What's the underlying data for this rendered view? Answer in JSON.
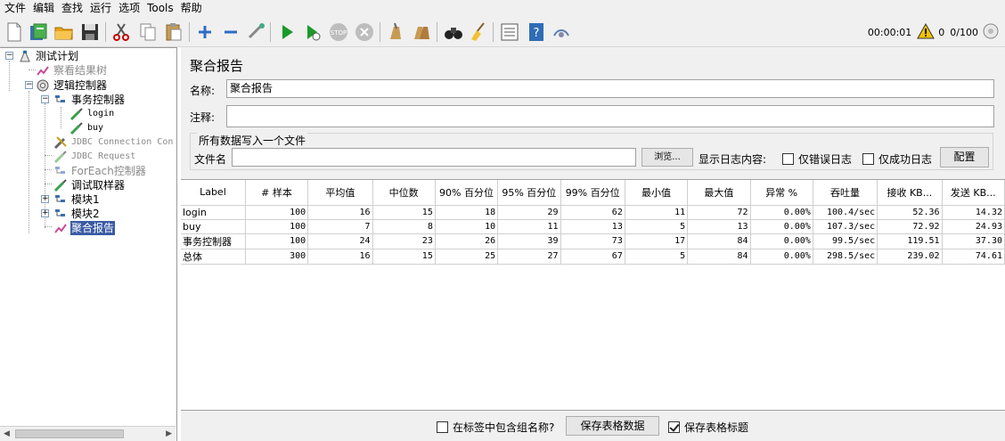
{
  "menu": [
    "文件",
    "编辑",
    "查找",
    "运行",
    "选项",
    "Tools",
    "帮助"
  ],
  "toolbar": {
    "timer": "00:00:01",
    "error_count": "0",
    "threads": "0/100"
  },
  "tree": {
    "nodes": [
      {
        "label": "测试计划"
      },
      {
        "label": "察看结果树"
      },
      {
        "label": "逻辑控制器"
      },
      {
        "label": "事务控制器"
      },
      {
        "label": "login"
      },
      {
        "label": "buy"
      },
      {
        "label": "JDBC Connection Con"
      },
      {
        "label": "JDBC Request"
      },
      {
        "label": "ForEach控制器"
      },
      {
        "label": "调试取样器"
      },
      {
        "label": "模块1"
      },
      {
        "label": "模块2"
      },
      {
        "label": "聚合报告"
      }
    ]
  },
  "panel": {
    "title": "聚合报告",
    "name_label": "名称:",
    "name_value": "聚合报告",
    "comment_label": "注释:",
    "comment_value": "",
    "file_section_title": "所有数据写入一个文件",
    "filename_label": "文件名",
    "filename_value": "",
    "browse_button": "浏览...",
    "log_display_label": "显示日志内容:",
    "errors_only_label": "仅错误日志",
    "success_only_label": "仅成功日志",
    "configure_button": "配置"
  },
  "table": {
    "columns": [
      "Label",
      "# 样本",
      "平均值",
      "中位数",
      "90% 百分位",
      "95% 百分位",
      "99% 百分位",
      "最小值",
      "最大值",
      "异常 %",
      "吞吐量",
      "接收 KB...",
      "发送 KB..."
    ],
    "rows": [
      [
        "login",
        "100",
        "16",
        "15",
        "18",
        "29",
        "62",
        "11",
        "72",
        "0.00%",
        "100.4/sec",
        "52.36",
        "14.32"
      ],
      [
        "buy",
        "100",
        "7",
        "8",
        "10",
        "11",
        "13",
        "5",
        "13",
        "0.00%",
        "107.3/sec",
        "72.92",
        "24.93"
      ],
      [
        "事务控制器",
        "100",
        "24",
        "23",
        "26",
        "39",
        "73",
        "17",
        "84",
        "0.00%",
        "99.5/sec",
        "119.51",
        "37.30"
      ],
      [
        "总体",
        "300",
        "16",
        "15",
        "25",
        "27",
        "67",
        "5",
        "84",
        "0.00%",
        "298.5/sec",
        "239.02",
        "74.61"
      ]
    ]
  },
  "footer": {
    "include_group_label": "在标签中包含组名称?",
    "save_table_button": "保存表格数据",
    "save_header_label": "保存表格标题"
  },
  "colors": {
    "selection": "#3a5aa5",
    "run_green": "#1a9a2a",
    "warning_yellow": "#f5c400"
  }
}
